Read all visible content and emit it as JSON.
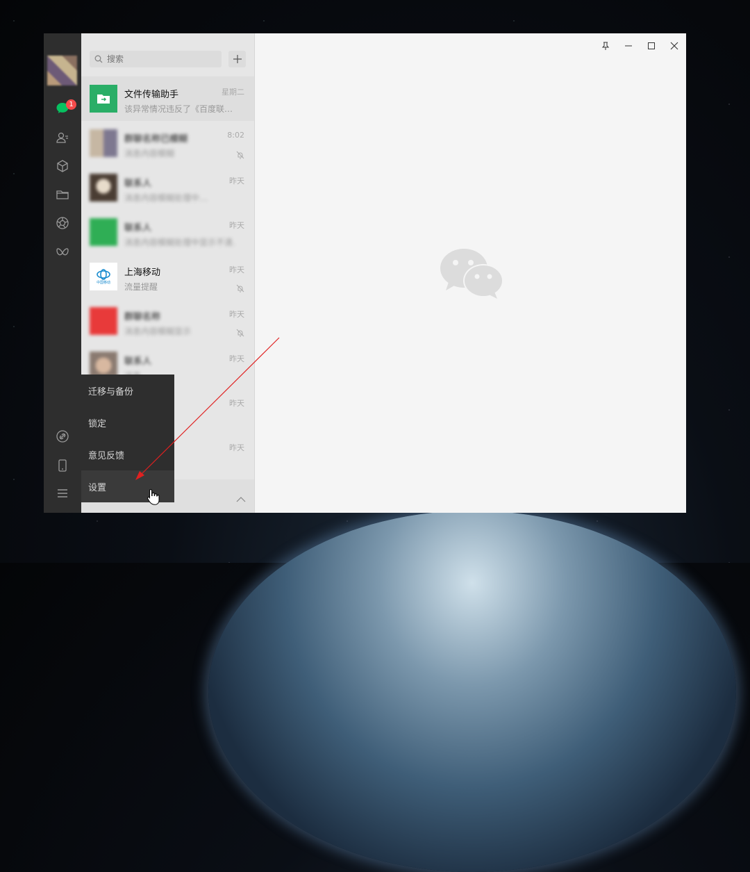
{
  "search": {
    "placeholder": "搜索"
  },
  "sidebar": {
    "badge_count": "1",
    "icons": [
      "chat-icon",
      "contacts-icon",
      "favorites-cube-icon",
      "files-folder-icon",
      "moments-aperture-icon",
      "mini-program-icon",
      "link-icon",
      "phone-icon",
      "menu-icon"
    ]
  },
  "chats": [
    {
      "name": "文件传输助手",
      "time": "星期二",
      "preview": "该异常情况违反了《百度联…",
      "muted": false,
      "avatar": "file-transfer"
    },
    {
      "name": "群聊名称已模糊",
      "time": "8:02",
      "preview": "消息内容模糊",
      "muted": true,
      "avatar": "blurred"
    },
    {
      "name": "联系人",
      "time": "昨天",
      "preview": "消息内容模糊处理中…",
      "muted": false,
      "avatar": "blurred"
    },
    {
      "name": "联系人",
      "time": "昨天",
      "preview": "消息内容模糊处理中显示不清…",
      "muted": false,
      "avatar": "blurred-green"
    },
    {
      "name": "上海移动",
      "time": "昨天",
      "preview": "流量提醒",
      "muted": true,
      "avatar": "china-mobile"
    },
    {
      "name": "群聊名称",
      "time": "昨天",
      "preview": "消息内容模糊显示",
      "muted": true,
      "avatar": "blurred-red"
    },
    {
      "name": "联系人",
      "time": "昨天",
      "preview": "消息",
      "muted": false,
      "avatar": "blurred"
    },
    {
      "name": "",
      "time": "昨天",
      "preview": "",
      "muted": false,
      "avatar": "hidden"
    },
    {
      "name": "",
      "time": "昨天",
      "preview": "]",
      "muted": false,
      "avatar": "hidden"
    }
  ],
  "china_mobile_logo_text": "中国移动",
  "menu": {
    "items": [
      "迁移与备份",
      "锁定",
      "意见反馈",
      "设置"
    ]
  },
  "colors": {
    "sidebar": "#2e2e2e",
    "accent": "#07c160",
    "badge": "#f44b4b",
    "annotation_arrow": "#e02020"
  }
}
